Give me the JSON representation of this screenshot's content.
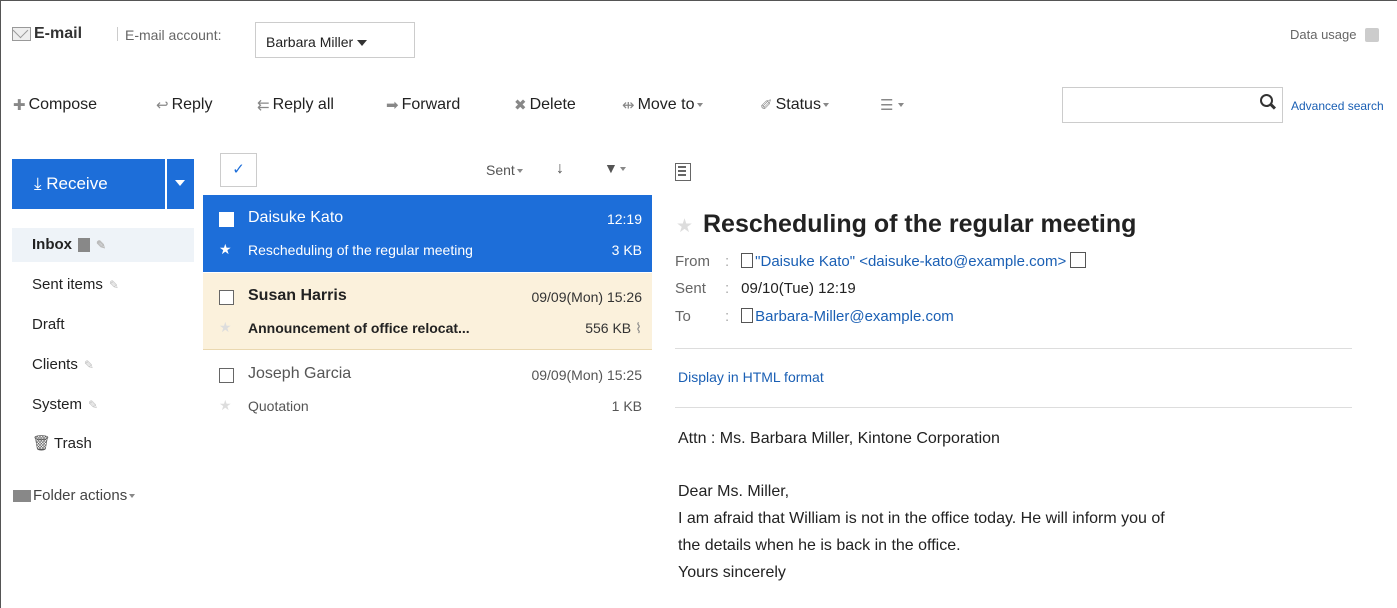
{
  "header": {
    "app_title": "E-mail",
    "account_label": "E-mail account:",
    "account_value": "Barbara Miller",
    "data_usage": "Data usage"
  },
  "toolbar": {
    "compose": "Compose",
    "reply": "Reply",
    "reply_all": "Reply all",
    "forward": "Forward",
    "delete": "Delete",
    "move_to": "Move to",
    "status": "Status",
    "search_placeholder": "",
    "advanced_search": "Advanced search"
  },
  "sidebar": {
    "receive": "Receive",
    "folders": [
      {
        "label": "Inbox"
      },
      {
        "label": "Sent items"
      },
      {
        "label": "Draft"
      },
      {
        "label": "Clients"
      },
      {
        "label": "System"
      },
      {
        "label": "Trash"
      }
    ],
    "folder_actions": "Folder actions"
  },
  "list": {
    "sort_label": "Sent",
    "messages": [
      {
        "sender": "Daisuke Kato",
        "time": "12:19",
        "subject": "Rescheduling of the regular meeting",
        "size": "3 KB",
        "state": "selected",
        "starred": true
      },
      {
        "sender": "Susan Harris",
        "time": "09/09(Mon) 15:26",
        "subject": "Announcement of office relocat...",
        "size": "556 KB",
        "state": "unread",
        "attachment": true
      },
      {
        "sender": "Joseph Garcia",
        "time": "09/09(Mon) 15:25",
        "subject": "Quotation",
        "size": "1 KB",
        "state": "read"
      }
    ]
  },
  "detail": {
    "subject": "Rescheduling of the regular meeting",
    "from_label": "From",
    "from_value": "\"Daisuke Kato\" <daisuke-kato@example.com>",
    "sent_label": "Sent",
    "sent_value": "09/10(Tue) 12:19",
    "to_label": "To",
    "to_value": "Barbara-Miller@example.com",
    "html_link": "Display in HTML format",
    "body": [
      "Attn : Ms. Barbara Miller, Kintone Corporation",
      "Dear Ms. Miller,",
      "I am afraid that William is not in the office today. He will inform you of",
      "the details when he is back in the office.",
      "Yours sincerely"
    ]
  }
}
